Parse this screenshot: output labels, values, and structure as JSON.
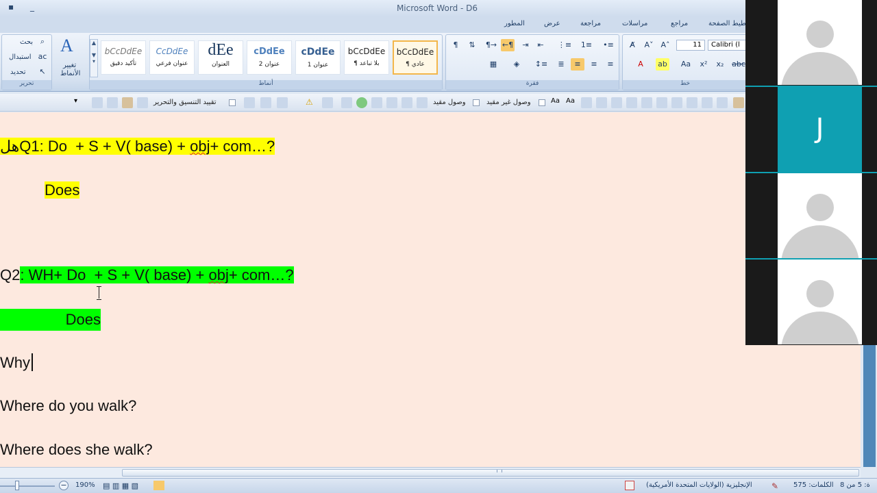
{
  "window": {
    "title": "Microsoft Word - D6",
    "minimize": "_"
  },
  "tabs": [
    {
      "label": "المطور"
    },
    {
      "label": "عرض"
    },
    {
      "label": "مراجعة"
    },
    {
      "label": "مراسلات"
    },
    {
      "label": "مراجع"
    },
    {
      "label": "تخطيط الصفحة"
    }
  ],
  "ribbon": {
    "editing": {
      "find": "بحث",
      "replace": "استبدال",
      "select": "تحديد",
      "group": "تحرير"
    },
    "change_styles": {
      "line1": "تغيير",
      "line2": "الأنماط",
      "icon": "A"
    },
    "styles": {
      "group": "أنماط",
      "items": [
        {
          "sample": "bCcDdEe",
          "name": "تأكيد دقيق"
        },
        {
          "sample": "CcDdEe",
          "name": "عنوان فرعي"
        },
        {
          "sample": "dEe",
          "name": "العنوان"
        },
        {
          "sample": "cDdEe",
          "name": "عنوان 2"
        },
        {
          "sample": "cDdEe",
          "name": "عنوان 1"
        },
        {
          "sample": "bCcDdEe",
          "name": "¶ بلا تباعد"
        },
        {
          "sample": "bCcDdEe",
          "name": "¶ عادي"
        }
      ]
    },
    "paragraph": {
      "group": "فقرة"
    },
    "font": {
      "group": "خط",
      "size": "11",
      "name": "Calibri (ا"
    }
  },
  "toolbar2": {
    "restrict": "تقييد التنسيق والتحرير",
    "limited": "وصول غير مقيد",
    "restricted": "وصول مقيد"
  },
  "document": {
    "q1": {
      "prefix": "هل",
      "text": "Q1: Do  + S + V( base) + ",
      "obj": "obj",
      "rest": "+ com…?"
    },
    "does1": "Does",
    "q2": {
      "prefix": "Q2",
      "text": ": WH+ Do  + S + V( base) + ",
      "obj": "obj",
      "rest": "+ com…?"
    },
    "does2": "Does",
    "why": "Why",
    "line1": "Where do you walk?",
    "line2": "Where does she walk?"
  },
  "status": {
    "zoom": "190%",
    "language": "الإنجليزية (الولايات المتحدة الأمريكية)",
    "words": "الكلمات: 575",
    "page": "ة: 5 من 8"
  },
  "participants": [
    {
      "type": "avatar"
    },
    {
      "type": "initial",
      "initial": "J"
    },
    {
      "type": "avatar"
    },
    {
      "type": "avatar"
    }
  ],
  "colors": {
    "doc_background": "#fde9df",
    "highlight_yellow": "#ffff00",
    "highlight_green": "#00ff00",
    "active_speaker": "#0fa0b2"
  }
}
